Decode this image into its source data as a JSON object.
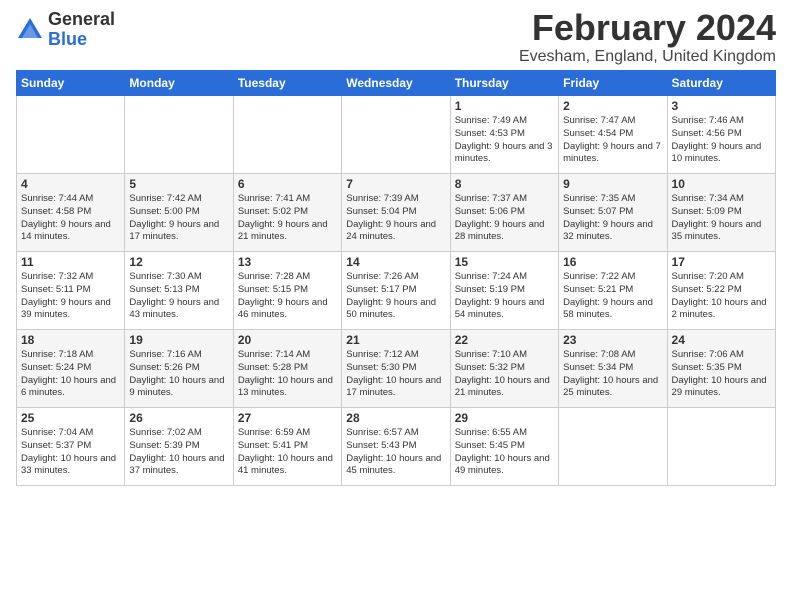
{
  "logo": {
    "general": "General",
    "blue": "Blue"
  },
  "header": {
    "month": "February 2024",
    "location": "Evesham, England, United Kingdom"
  },
  "weekdays": [
    "Sunday",
    "Monday",
    "Tuesday",
    "Wednesday",
    "Thursday",
    "Friday",
    "Saturday"
  ],
  "weeks": [
    [
      {
        "day": "",
        "info": ""
      },
      {
        "day": "",
        "info": ""
      },
      {
        "day": "",
        "info": ""
      },
      {
        "day": "",
        "info": ""
      },
      {
        "day": "1",
        "info": "Sunrise: 7:49 AM\nSunset: 4:53 PM\nDaylight: 9 hours\nand 3 minutes."
      },
      {
        "day": "2",
        "info": "Sunrise: 7:47 AM\nSunset: 4:54 PM\nDaylight: 9 hours\nand 7 minutes."
      },
      {
        "day": "3",
        "info": "Sunrise: 7:46 AM\nSunset: 4:56 PM\nDaylight: 9 hours\nand 10 minutes."
      }
    ],
    [
      {
        "day": "4",
        "info": "Sunrise: 7:44 AM\nSunset: 4:58 PM\nDaylight: 9 hours\nand 14 minutes."
      },
      {
        "day": "5",
        "info": "Sunrise: 7:42 AM\nSunset: 5:00 PM\nDaylight: 9 hours\nand 17 minutes."
      },
      {
        "day": "6",
        "info": "Sunrise: 7:41 AM\nSunset: 5:02 PM\nDaylight: 9 hours\nand 21 minutes."
      },
      {
        "day": "7",
        "info": "Sunrise: 7:39 AM\nSunset: 5:04 PM\nDaylight: 9 hours\nand 24 minutes."
      },
      {
        "day": "8",
        "info": "Sunrise: 7:37 AM\nSunset: 5:06 PM\nDaylight: 9 hours\nand 28 minutes."
      },
      {
        "day": "9",
        "info": "Sunrise: 7:35 AM\nSunset: 5:07 PM\nDaylight: 9 hours\nand 32 minutes."
      },
      {
        "day": "10",
        "info": "Sunrise: 7:34 AM\nSunset: 5:09 PM\nDaylight: 9 hours\nand 35 minutes."
      }
    ],
    [
      {
        "day": "11",
        "info": "Sunrise: 7:32 AM\nSunset: 5:11 PM\nDaylight: 9 hours\nand 39 minutes."
      },
      {
        "day": "12",
        "info": "Sunrise: 7:30 AM\nSunset: 5:13 PM\nDaylight: 9 hours\nand 43 minutes."
      },
      {
        "day": "13",
        "info": "Sunrise: 7:28 AM\nSunset: 5:15 PM\nDaylight: 9 hours\nand 46 minutes."
      },
      {
        "day": "14",
        "info": "Sunrise: 7:26 AM\nSunset: 5:17 PM\nDaylight: 9 hours\nand 50 minutes."
      },
      {
        "day": "15",
        "info": "Sunrise: 7:24 AM\nSunset: 5:19 PM\nDaylight: 9 hours\nand 54 minutes."
      },
      {
        "day": "16",
        "info": "Sunrise: 7:22 AM\nSunset: 5:21 PM\nDaylight: 9 hours\nand 58 minutes."
      },
      {
        "day": "17",
        "info": "Sunrise: 7:20 AM\nSunset: 5:22 PM\nDaylight: 10 hours\nand 2 minutes."
      }
    ],
    [
      {
        "day": "18",
        "info": "Sunrise: 7:18 AM\nSunset: 5:24 PM\nDaylight: 10 hours\nand 6 minutes."
      },
      {
        "day": "19",
        "info": "Sunrise: 7:16 AM\nSunset: 5:26 PM\nDaylight: 10 hours\nand 9 minutes."
      },
      {
        "day": "20",
        "info": "Sunrise: 7:14 AM\nSunset: 5:28 PM\nDaylight: 10 hours\nand 13 minutes."
      },
      {
        "day": "21",
        "info": "Sunrise: 7:12 AM\nSunset: 5:30 PM\nDaylight: 10 hours\nand 17 minutes."
      },
      {
        "day": "22",
        "info": "Sunrise: 7:10 AM\nSunset: 5:32 PM\nDaylight: 10 hours\nand 21 minutes."
      },
      {
        "day": "23",
        "info": "Sunrise: 7:08 AM\nSunset: 5:34 PM\nDaylight: 10 hours\nand 25 minutes."
      },
      {
        "day": "24",
        "info": "Sunrise: 7:06 AM\nSunset: 5:35 PM\nDaylight: 10 hours\nand 29 minutes."
      }
    ],
    [
      {
        "day": "25",
        "info": "Sunrise: 7:04 AM\nSunset: 5:37 PM\nDaylight: 10 hours\nand 33 minutes."
      },
      {
        "day": "26",
        "info": "Sunrise: 7:02 AM\nSunset: 5:39 PM\nDaylight: 10 hours\nand 37 minutes."
      },
      {
        "day": "27",
        "info": "Sunrise: 6:59 AM\nSunset: 5:41 PM\nDaylight: 10 hours\nand 41 minutes."
      },
      {
        "day": "28",
        "info": "Sunrise: 6:57 AM\nSunset: 5:43 PM\nDaylight: 10 hours\nand 45 minutes."
      },
      {
        "day": "29",
        "info": "Sunrise: 6:55 AM\nSunset: 5:45 PM\nDaylight: 10 hours\nand 49 minutes."
      },
      {
        "day": "",
        "info": ""
      },
      {
        "day": "",
        "info": ""
      }
    ]
  ]
}
